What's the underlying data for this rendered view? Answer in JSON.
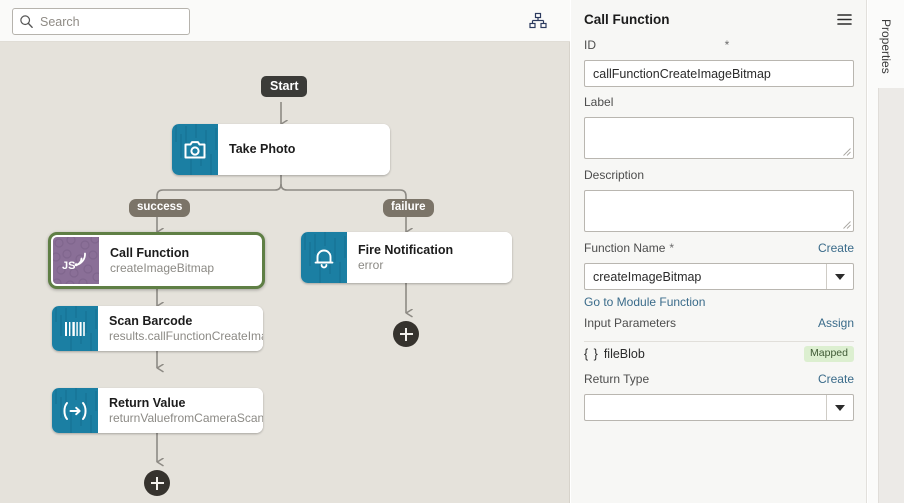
{
  "canvas": {
    "search": {
      "placeholder": "Search",
      "value": ""
    },
    "hierarchy_icon": "hierarchy-icon",
    "start_label": "Start",
    "edge_labels": {
      "success": "success",
      "failure": "failure"
    },
    "nodes": [
      {
        "id": "take-photo",
        "title": "Take Photo",
        "subtitle": "",
        "icon": "camera-icon",
        "icon_color": "#1b7fa3",
        "selected": false
      },
      {
        "id": "call-function",
        "title": "Call Function",
        "subtitle": "createImageBitmap",
        "icon": "js-function-icon",
        "icon_color": "#8a6f97",
        "selected": true
      },
      {
        "id": "fire-notification",
        "title": "Fire Notification",
        "subtitle": "error",
        "icon": "bell-icon",
        "icon_color": "#1b7fa3",
        "selected": false
      },
      {
        "id": "scan-barcode",
        "title": "Scan Barcode",
        "subtitle": "results.callFunctionCreateImageBitmap",
        "icon": "barcode-icon",
        "icon_color": "#1b7fa3",
        "selected": false
      },
      {
        "id": "return-value",
        "title": "Return Value",
        "subtitle": "returnValuefromCameraScan",
        "icon": "return-arrow-icon",
        "icon_color": "#1b7fa3",
        "selected": false
      }
    ],
    "add_buttons": [
      {
        "id": "add-after-return-value",
        "label": "+"
      },
      {
        "id": "add-after-fire-notification",
        "label": "+"
      }
    ]
  },
  "properties": {
    "title": "Call Function",
    "menu_icon": "hamburger-menu-icon",
    "fields": {
      "id": {
        "label": "ID",
        "required": "*",
        "value": "callFunctionCreateImageBitmap"
      },
      "label": {
        "label": "Label",
        "value": ""
      },
      "description": {
        "label": "Description",
        "value": ""
      },
      "function_name": {
        "label": "Function Name",
        "required": "*",
        "action": "Create",
        "value": "createImageBitmap",
        "sublink": "Go to Module Function"
      },
      "input_parameters": {
        "label": "Input Parameters",
        "action": "Assign",
        "rows": [
          {
            "braces": "{ }",
            "name": "fileBlob",
            "status": "Mapped"
          }
        ]
      },
      "return_type": {
        "label": "Return Type",
        "action": "Create",
        "value": ""
      }
    }
  },
  "tabstrip": {
    "tabs": [
      {
        "id": "properties",
        "label": "Properties"
      }
    ]
  },
  "colors": {
    "canvas_bg": "#e5e2db",
    "node_icon_blue": "#1b7fa3",
    "node_icon_purple": "#8a6f97",
    "selection_green": "#5f7f45",
    "badge_gray": "#7b7468",
    "start_dark": "#3b3b38",
    "link_blue": "#3a6b8a",
    "mapped_green_bg": "#dcefd0",
    "mapped_green_fg": "#3f5a35"
  }
}
